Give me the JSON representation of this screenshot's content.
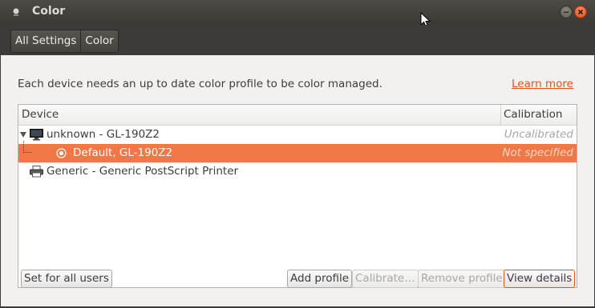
{
  "window": {
    "title": "Color"
  },
  "breadcrumbs": [
    {
      "label": "All Settings"
    },
    {
      "label": "Color"
    }
  ],
  "info_text": "Each device needs an up to date color profile to be color managed.",
  "learn_more": "Learn more",
  "tree": {
    "columns": {
      "device": "Device",
      "calibration": "Calibration"
    },
    "rows": [
      {
        "label": "unknown - GL-190Z2",
        "status": "Uncalibrated",
        "icon": "monitor-icon",
        "expanded": true
      },
      {
        "label": "Default, GL-190Z2",
        "status": "Not specified",
        "icon": "radio-selected-icon",
        "selected": true
      },
      {
        "label": "Generic - Generic PostScript Printer",
        "status": "",
        "icon": "printer-icon"
      }
    ]
  },
  "buttons": {
    "set_all_users": "Set for all users",
    "add_profile": "Add profile",
    "calibrate": "Calibrate…",
    "remove_profile": "Remove profile",
    "view_details": "View details"
  },
  "colors": {
    "accent": "#f07746",
    "link": "#e2531d",
    "titlebar": "#3c3b37"
  }
}
